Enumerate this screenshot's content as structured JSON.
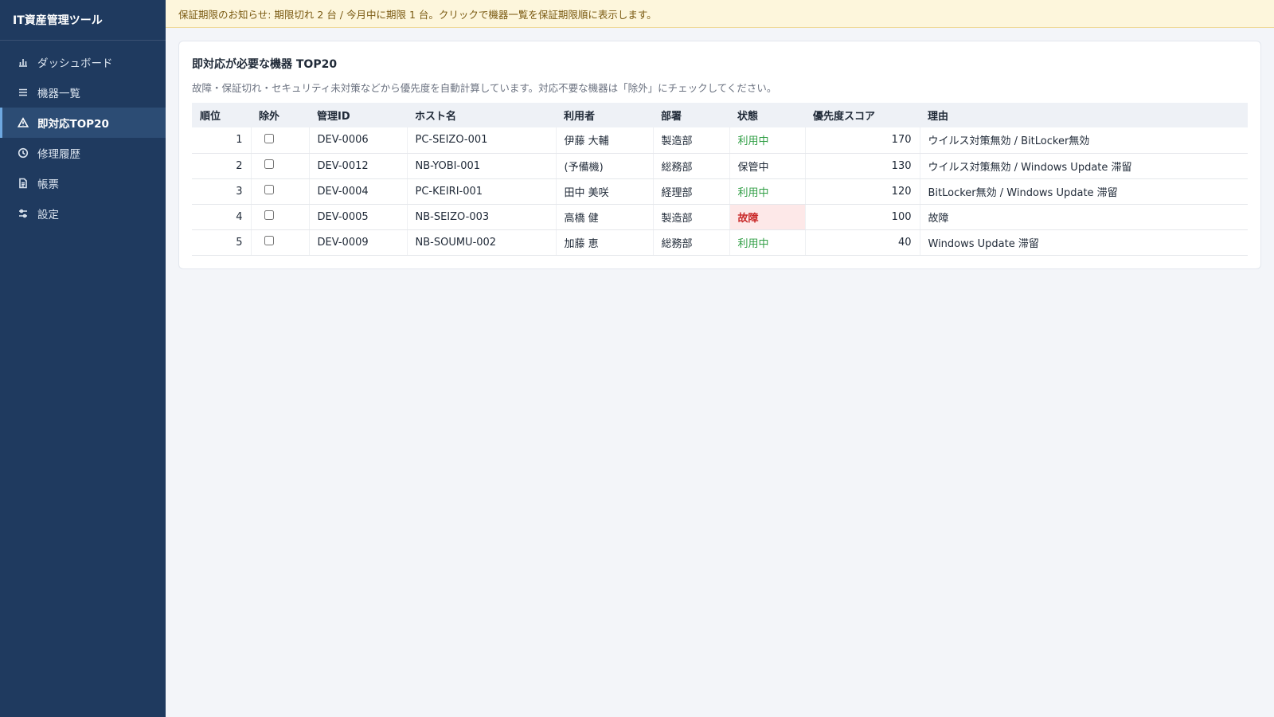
{
  "app": {
    "title": "IT資産管理ツール"
  },
  "sidebar": {
    "items": [
      {
        "label": "ダッシュボード",
        "icon": "bar-chart-icon"
      },
      {
        "label": "機器一覧",
        "icon": "list-icon"
      },
      {
        "label": "即対応TOP20",
        "icon": "warning-icon",
        "active": true
      },
      {
        "label": "修理履歴",
        "icon": "clock-icon"
      },
      {
        "label": "帳票",
        "icon": "document-icon"
      },
      {
        "label": "設定",
        "icon": "sliders-icon"
      }
    ]
  },
  "banner": {
    "text": "保証期限のお知らせ: 期限切れ 2 台 / 今月中に期限 1 台。クリックで機器一覧を保証期限順に表示します。"
  },
  "card": {
    "title": "即対応が必要な機器 TOP20",
    "description": "故障・保証切れ・セキュリティ未対策などから優先度を自動計算しています。対応不要な機器は「除外」にチェックしてください。"
  },
  "table": {
    "headers": {
      "rank": "順位",
      "exclude": "除外",
      "id": "管理ID",
      "host": "ホスト名",
      "user": "利用者",
      "dept": "部署",
      "state": "状態",
      "score": "優先度スコア",
      "reason": "理由"
    },
    "rows": [
      {
        "rank": "1",
        "id": "DEV-0006",
        "host": "PC-SEIZO-001",
        "user": "伊藤 大輔",
        "dept": "製造部",
        "state": "利用中",
        "score": "170",
        "reason": "ウイルス対策無効 / BitLocker無効"
      },
      {
        "rank": "2",
        "id": "DEV-0012",
        "host": "NB-YOBI-001",
        "user": "(予備機)",
        "dept": "総務部",
        "state": "保管中",
        "score": "130",
        "reason": "ウイルス対策無効 / Windows Update 滞留"
      },
      {
        "rank": "3",
        "id": "DEV-0004",
        "host": "PC-KEIRI-001",
        "user": "田中 美咲",
        "dept": "経理部",
        "state": "利用中",
        "score": "120",
        "reason": "BitLocker無効 / Windows Update 滞留"
      },
      {
        "rank": "4",
        "id": "DEV-0005",
        "host": "NB-SEIZO-003",
        "user": "高橋 健",
        "dept": "製造部",
        "state": "故障",
        "score": "100",
        "reason": "故障"
      },
      {
        "rank": "5",
        "id": "DEV-0009",
        "host": "NB-SOUMU-002",
        "user": "加藤 恵",
        "dept": "総務部",
        "state": "利用中",
        "score": "40",
        "reason": "Windows Update 滞留"
      }
    ]
  },
  "colors": {
    "sidebar_bg": "#1f3a5f",
    "active_item_bg": "#2c4c74",
    "banner_bg": "#fdf6dc",
    "status_in_use": "#2f9e44",
    "status_failure": "#c92a2a",
    "status_failure_bg": "#fde8e8"
  }
}
